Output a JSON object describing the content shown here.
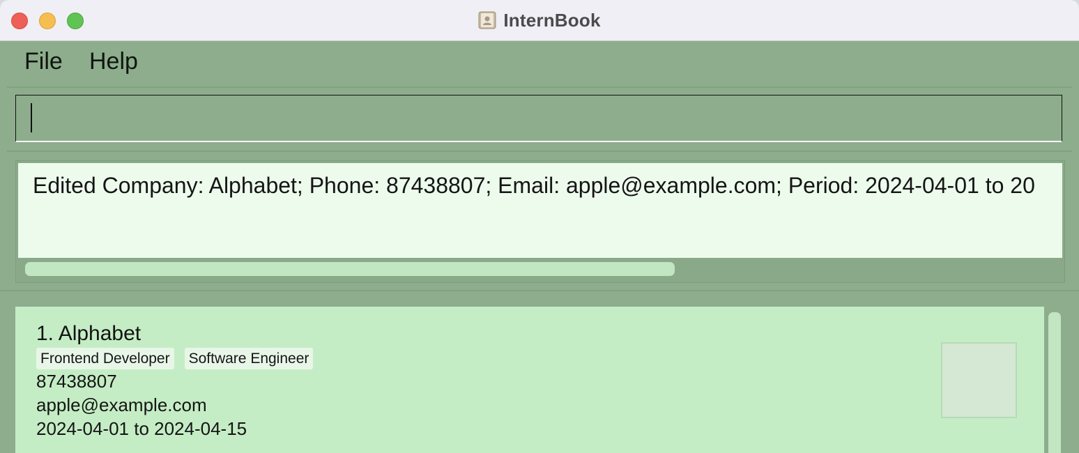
{
  "window": {
    "title": "InternBook",
    "app_icon": "contacts-book-icon"
  },
  "menu": {
    "file_label": "File",
    "help_label": "Help"
  },
  "command": {
    "value": "",
    "placeholder": ""
  },
  "result": {
    "message": "Edited Company: Alphabet; Phone: 87438807; Email: apple@example.com; Period: 2024-04-01 to 20"
  },
  "companies": [
    {
      "index_title": "1.  Alphabet",
      "tags": [
        "Frontend Developer",
        "Software Engineer"
      ],
      "phone": "87438807",
      "email": "apple@example.com",
      "period": "2024-04-01 to 2024-04-15"
    }
  ],
  "colors": {
    "window_bg": "#8dad8d",
    "result_bg": "#edfbed",
    "card_bg": "#c5edc5",
    "tag_bg": "#e8f6e8"
  }
}
